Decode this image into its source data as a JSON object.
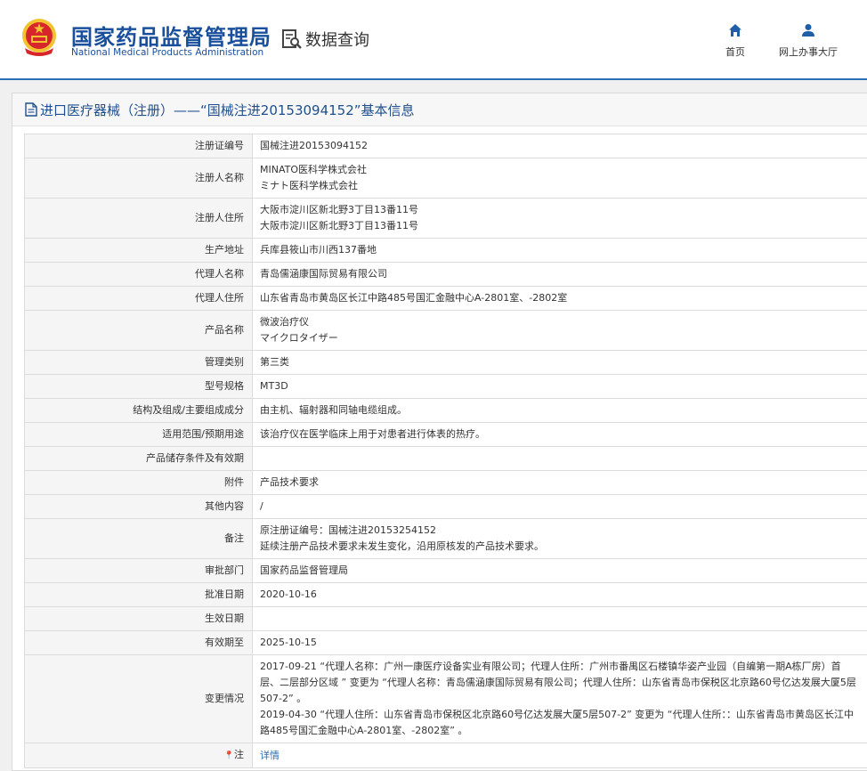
{
  "header": {
    "org_name_cn": "国家药品监督管理局",
    "org_name_en": "National Medical Products Administration",
    "data_query": "数据查询",
    "nav": {
      "home": "首页",
      "online_hall": "网上办事大厅"
    }
  },
  "panel": {
    "title": "进口医疗器械（注册）——“国械注进20153094152”基本信息"
  },
  "fields": [
    {
      "label": "注册证编号",
      "lines": [
        "国械注进20153094152"
      ]
    },
    {
      "label": "注册人名称",
      "lines": [
        "MINATO医科学株式会社",
        "ミナト医科学株式会社"
      ]
    },
    {
      "label": "注册人住所",
      "lines": [
        "大阪市淀川区新北野3丁目13番11号",
        "大阪市淀川区新北野3丁目13番11号"
      ]
    },
    {
      "label": "生产地址",
      "lines": [
        "兵库县筱山市川西137番地"
      ]
    },
    {
      "label": "代理人名称",
      "lines": [
        "青岛儒涵康国际贸易有限公司"
      ]
    },
    {
      "label": "代理人住所",
      "lines": [
        "山东省青岛市黄岛区长江中路485号国汇金融中心A-2801室、-2802室"
      ]
    },
    {
      "label": "产品名称",
      "lines": [
        "微波治疗仪",
        "マイクロタイザー"
      ]
    },
    {
      "label": "管理类别",
      "lines": [
        "第三类"
      ]
    },
    {
      "label": "型号规格",
      "lines": [
        "MT3D"
      ]
    },
    {
      "label": "结构及组成/主要组成成分",
      "lines": [
        "由主机、辐射器和同轴电缆组成。"
      ]
    },
    {
      "label": "适用范围/预期用途",
      "lines": [
        "该治疗仪在医学临床上用于对患者进行体表的热疗。"
      ]
    },
    {
      "label": "产品储存条件及有效期",
      "lines": [
        ""
      ]
    },
    {
      "label": "附件",
      "lines": [
        "产品技术要求"
      ]
    },
    {
      "label": "其他内容",
      "lines": [
        "/"
      ]
    },
    {
      "label": "备注",
      "lines": [
        "原注册证编号：国械注进20153254152",
        "延续注册产品技术要求未发生变化，沿用原核发的产品技术要求。"
      ]
    },
    {
      "label": "审批部门",
      "lines": [
        "国家药品监督管理局"
      ]
    },
    {
      "label": "批准日期",
      "lines": [
        "2020-10-16"
      ]
    },
    {
      "label": "生效日期",
      "lines": [
        ""
      ]
    },
    {
      "label": "有效期至",
      "lines": [
        "2025-10-15"
      ]
    },
    {
      "label": "变更情况",
      "lines": [
        "2017-09-21 “代理人名称：广州一康医疗设备实业有限公司；代理人住所：广州市番禺区石楼镇华姿产业园（自编第一期A栋厂房）首层、二层部分区域 ” 变更为 “代理人名称：青岛儒涵康国际贸易有限公司；代理人住所：山东省青岛市保税区北京路60号亿达发展大厦5层507-2” 。",
        "2019-04-30 “代理人住所：山东省青岛市保税区北京路60号亿达发展大厦5层507-2” 变更为 “代理人住所：：山东省青岛市黄岛区长江中路485号国汇金融中心A-2801室、-2802室” 。"
      ]
    }
  ],
  "note_row": {
    "label": "注",
    "link": "详情"
  },
  "colors": {
    "brand_blue": "#1a4f9c",
    "link_blue": "#2a6fb6",
    "emblem_red": "#d6262b",
    "emblem_gold": "#f2c230"
  },
  "icons": {
    "emblem": "national-emblem",
    "data_query": "document-search-icon",
    "home": "home-icon",
    "online_hall": "user-icon",
    "panel_title": "document-icon",
    "note": "location-pin-icon"
  }
}
